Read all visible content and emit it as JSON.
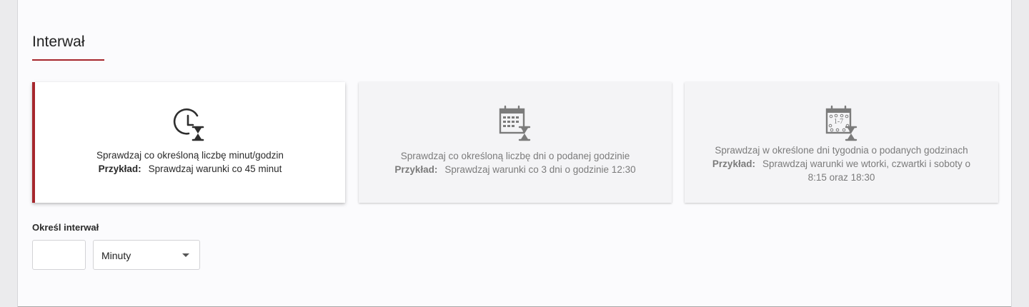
{
  "section": {
    "title": "Interwał"
  },
  "cards": [
    {
      "icon": "clock-hourglass-icon",
      "description": "Sprawdzaj co określoną liczbę minut/godzin",
      "example_label": "Przykład:",
      "example": "Sprawdzaj warunki co 45 minut",
      "selected": true
    },
    {
      "icon": "calendar-hourglass-icon",
      "description": "Sprawdzaj co określoną liczbę dni o podanej godzinie",
      "example_label": "Przykład:",
      "example": "Sprawdzaj warunki co 3 dni o godzinie 12:30",
      "selected": false
    },
    {
      "icon": "calendar-weekdays-hourglass-icon",
      "icon_text": "1-7",
      "description": "Sprawdzaj w określone dni tygodnia o podanych godzinach",
      "example_label": "Przykład:",
      "example": "Sprawdzaj warunki we wtorki, czwartki i soboty o 8:15 oraz 18:30",
      "selected": false
    }
  ],
  "interval": {
    "label": "Określ interwał",
    "value": "",
    "unit": "Minuty"
  },
  "colors": {
    "accent": "#a6262c"
  }
}
